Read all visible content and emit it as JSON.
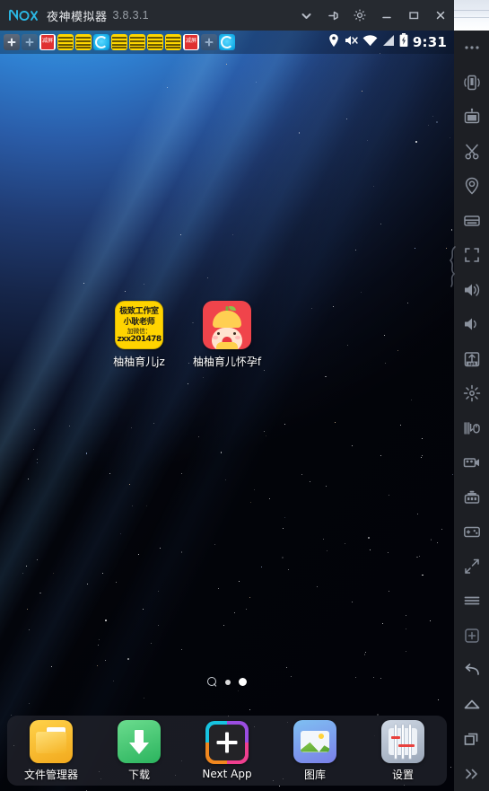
{
  "window": {
    "brand": "nox",
    "title": "夜神模拟器",
    "version": "3.8.3.1",
    "controls": [
      {
        "name": "chevron-down",
        "label": "展开"
      },
      {
        "name": "pin",
        "label": "置顶"
      },
      {
        "name": "gear",
        "label": "设置"
      },
      {
        "name": "minimize",
        "label": "最小化"
      },
      {
        "name": "maximize",
        "label": "最大化"
      },
      {
        "name": "close",
        "label": "关闭"
      }
    ]
  },
  "statusbar": {
    "clock": "9:31",
    "left_icons": [
      {
        "name": "add-app-icon",
        "type": "plus"
      },
      {
        "name": "add-app-dim-icon",
        "type": "plus-dim"
      },
      {
        "name": "red-app-icon",
        "type": "red",
        "text": "减屏"
      },
      {
        "name": "yellow-ad-icon-1",
        "type": "yellow"
      },
      {
        "name": "yellow-ad-icon-2",
        "type": "yellow"
      },
      {
        "name": "cyan-app-icon-1",
        "type": "cyan"
      },
      {
        "name": "yellow-ad-icon-3",
        "type": "yellow"
      },
      {
        "name": "yellow-ad-icon-4",
        "type": "yellow"
      },
      {
        "name": "yellow-ad-icon-5",
        "type": "yellow"
      },
      {
        "name": "yellow-ad-icon-6",
        "type": "yellow"
      },
      {
        "name": "red-app-icon-2",
        "type": "red",
        "text": "减屏"
      },
      {
        "name": "add-app-icon-2",
        "type": "plus-dim"
      },
      {
        "name": "cyan-app-icon-2",
        "type": "cyan"
      }
    ],
    "right_icons": [
      {
        "name": "location-icon"
      },
      {
        "name": "mute-icon"
      },
      {
        "name": "wifi-icon"
      },
      {
        "name": "signal-icon"
      },
      {
        "name": "battery-charging-icon"
      }
    ]
  },
  "home": {
    "apps": [
      {
        "name": "app-youyou-yuer-jz",
        "label": "柚柚育儿jz",
        "icon": "ad-yellow-icon",
        "icon_lines": [
          "极致工作室",
          "小耿老师",
          "加微信：",
          "zxx201478"
        ]
      },
      {
        "name": "app-youyou-yuer-huaiyun",
        "label": "柚柚育儿怀孕f",
        "icon": "baby-pomelo-icon"
      }
    ],
    "pager": {
      "search_icon": "search-icon",
      "pages": 2,
      "active": 2
    },
    "dock": [
      {
        "name": "dock-file-manager",
        "label": "文件管理器",
        "icon": "folder-icon"
      },
      {
        "name": "dock-downloads",
        "label": "下载",
        "icon": "download-arrow-icon"
      },
      {
        "name": "dock-next-app",
        "label": "Next App",
        "icon": "plus-square-icon"
      },
      {
        "name": "dock-gallery",
        "label": "图库",
        "icon": "photo-icon"
      },
      {
        "name": "dock-settings",
        "label": "设置",
        "icon": "sliders-icon"
      }
    ]
  },
  "toolbar": {
    "items": [
      {
        "name": "more-options-icon",
        "label": "更多"
      },
      {
        "name": "shake-phone-icon",
        "label": "摇一摇"
      },
      {
        "name": "video-record-icon",
        "label": "录制"
      },
      {
        "name": "scissors-screenshot-icon",
        "label": "截图"
      },
      {
        "name": "location-pin-icon",
        "label": "虚拟定位"
      },
      {
        "name": "keyboard-icon",
        "label": "键盘"
      },
      {
        "name": "fullscreen-icon",
        "label": "全屏"
      },
      {
        "name": "volume-up-icon",
        "label": "音量加"
      },
      {
        "name": "volume-down-icon",
        "label": "音量减"
      },
      {
        "name": "apk-install-icon",
        "label": "安装APK"
      },
      {
        "name": "shake-sparkle-icon",
        "label": "摇晃"
      },
      {
        "name": "key-mapping-icon",
        "label": "操作设置"
      },
      {
        "name": "screen-record-icon",
        "label": "录屏"
      },
      {
        "name": "multi-instance-icon",
        "label": "多开"
      },
      {
        "name": "gamepad-icon",
        "label": "手柄"
      },
      {
        "name": "share-resize-icon",
        "label": "分享"
      },
      {
        "name": "menu-hamburger-icon",
        "label": "菜单"
      },
      {
        "name": "add-square-icon",
        "label": "添加"
      },
      {
        "name": "back-arrow-icon",
        "label": "返回"
      },
      {
        "name": "home-icon",
        "label": "主页"
      },
      {
        "name": "recent-apps-icon",
        "label": "多任务"
      },
      {
        "name": "chevron-double-right-icon",
        "label": "收起"
      }
    ]
  },
  "colors": {
    "brand_cyan": "#2bb9e6",
    "titlebar": "#262a30",
    "toolbar": "#1d1f24",
    "accent_red": "#f0444b",
    "ad_yellow": "#ffd400"
  }
}
